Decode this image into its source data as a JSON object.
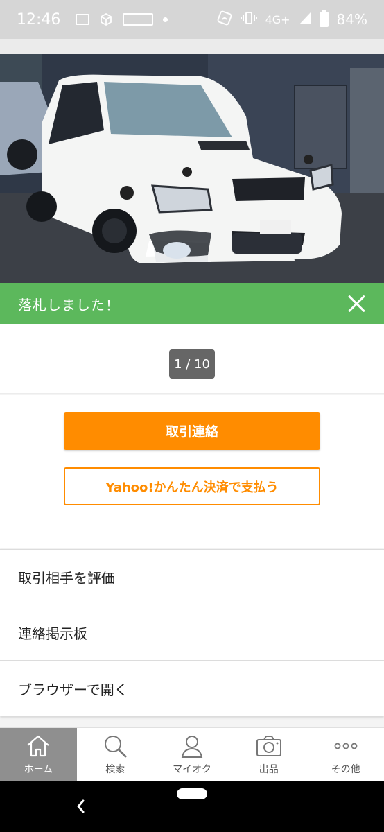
{
  "status_bar": {
    "time": "12:46",
    "network": "4G+",
    "battery": "84%"
  },
  "banner": {
    "text": "落札しました！"
  },
  "photo": {
    "counter": "1 / 10"
  },
  "actions": {
    "primary_label": "取引連絡",
    "secondary_label": "Yahoo!かんたん決済で支払う"
  },
  "menu": {
    "items": [
      {
        "label": "取引相手を評価"
      },
      {
        "label": "連絡掲示板"
      },
      {
        "label": "ブラウザーで開く"
      }
    ]
  },
  "bottom_nav": {
    "items": [
      {
        "label": "ホーム",
        "icon": "home-icon",
        "active": true
      },
      {
        "label": "検索",
        "icon": "search-icon",
        "active": false
      },
      {
        "label": "マイオク",
        "icon": "user-icon",
        "active": false
      },
      {
        "label": "出品",
        "icon": "camera-icon",
        "active": false
      },
      {
        "label": "その他",
        "icon": "more-icon",
        "active": false
      }
    ]
  },
  "colors": {
    "accent": "#ff8c00",
    "banner_green": "#5cb85c",
    "nav_active": "#8f8f8f"
  }
}
